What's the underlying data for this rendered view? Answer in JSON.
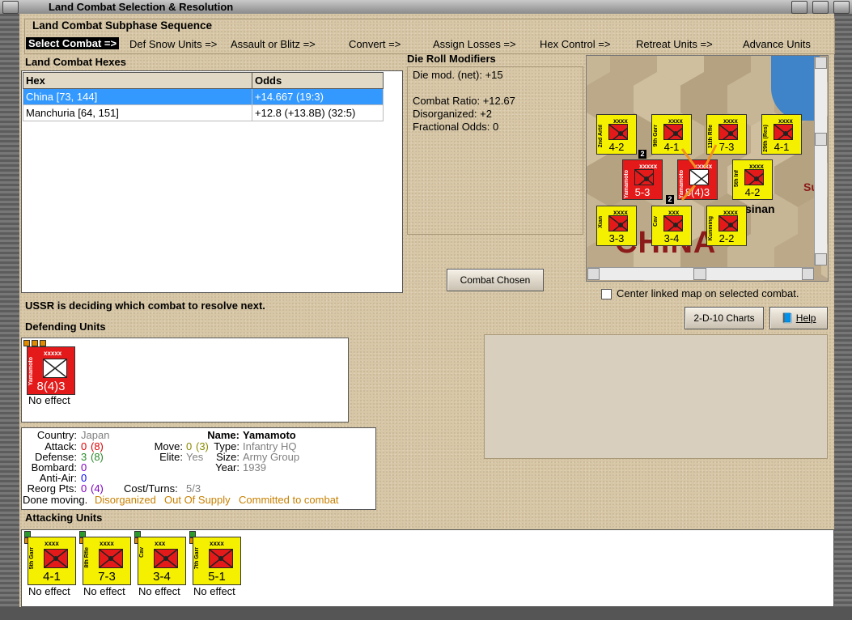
{
  "window": {
    "title": "Land Combat Selection & Resolution"
  },
  "sequence": {
    "title": "Land Combat Subphase Sequence",
    "steps": [
      "Select Combat =>",
      "Def Snow Units =>",
      "Assault or Blitz =>",
      "Convert =>",
      "Assign Losses =>",
      "Hex Control =>",
      "Retreat Units =>",
      "Advance Units"
    ],
    "active_index": 0
  },
  "hexes": {
    "title": "Land Combat Hexes",
    "columns": [
      "Hex",
      "Odds"
    ],
    "rows": [
      {
        "hex": "China [73, 144]",
        "odds": "+14.667 (19:3)",
        "selected": true
      },
      {
        "hex": "Manchuria [64, 151]",
        "odds": "+12.8 (+13.8B) (32:5)",
        "selected": false
      }
    ]
  },
  "modifiers": {
    "title": "Die Roll Modifiers",
    "die_mod": "Die mod. (net): +15",
    "combat_ratio": "Combat Ratio: +12.67",
    "disorganized": "Disorganized: +2",
    "fractional": "Fractional Odds: 0"
  },
  "map": {
    "label_china": "CHINA",
    "label_sinan": "sinan",
    "label_su": "Su",
    "stack_counts": [
      "2",
      "2"
    ]
  },
  "buttons": {
    "combat_chosen": "Combat Chosen",
    "charts": "2-D-10 Charts",
    "help": "Help"
  },
  "center_linked": {
    "label": "Center linked map on selected combat.",
    "checked": false
  },
  "status": "USSR is deciding which combat to resolve next.",
  "defending": {
    "title": "Defending Units",
    "units": [
      {
        "name": "Yamamoto",
        "size": "xxxxx",
        "strength": "8(4)3",
        "effect": "No effect",
        "color": "#e41a1a"
      }
    ]
  },
  "info": {
    "country_label": "Country:",
    "country": "Japan",
    "attack_label": "Attack:",
    "attack": "0",
    "attack_paren": "(8)",
    "defense_label": "Defense:",
    "defense": "3",
    "defense_paren": "(8)",
    "bombard_label": "Bombard:",
    "bombard": "0",
    "antiair_label": "Anti-Air:",
    "antiair": "0",
    "reorg_label": "Reorg Pts:",
    "reorg": "0",
    "reorg_paren": "(4)",
    "done": "Done moving.",
    "status_disorganized": "Disorganized",
    "status_supply": "Out Of Supply",
    "status_committed": "Committed to combat",
    "name_label": "Name:",
    "name": "Yamamoto",
    "move_label": "Move:",
    "move": "0",
    "move_paren": "(3)",
    "elite_label": "Elite:",
    "elite": "Yes",
    "type_label": "Type:",
    "type": "Infantry HQ",
    "size_label": "Size:",
    "size": "Army Group",
    "year_label": "Year:",
    "year": "1939",
    "cost_label": "Cost/Turns:",
    "cost": "5/3"
  },
  "attacking": {
    "title": "Attacking Units",
    "units": [
      {
        "name": "5th Garr",
        "size": "xxxx",
        "strength": "4-1",
        "effect": "No effect"
      },
      {
        "name": "8th Rfle",
        "size": "xxxx",
        "strength": "7-3",
        "effect": "No effect"
      },
      {
        "name": "Cav",
        "size": "xxx",
        "strength": "3-4",
        "effect": "No effect"
      },
      {
        "name": "7th Garr",
        "size": "xxxx",
        "strength": "5-1",
        "effect": "No effect"
      }
    ]
  },
  "map_units": [
    {
      "name": "2nd Artil",
      "size": "xxxx",
      "strength": "4-2"
    },
    {
      "name": "9th Garr",
      "size": "xxxx",
      "strength": "4-1"
    },
    {
      "name": "11th Rfle",
      "size": "xxxx",
      "strength": "7-3"
    },
    {
      "name": "29th (Res)",
      "size": "xxxx",
      "strength": "4-1"
    },
    {
      "name": "Yamamoto",
      "size": "xxxxx",
      "strength": "5-3"
    },
    {
      "name": "Yamamoto",
      "size": "xxxxx",
      "strength": "8(4)3"
    },
    {
      "name": "5th Inf",
      "size": "xxxx",
      "strength": "4-2"
    },
    {
      "name": "Xian",
      "size": "xxxx",
      "strength": "3-3"
    },
    {
      "name": "Cav",
      "size": "xxx",
      "strength": "3-4"
    },
    {
      "name": "Kunming",
      "size": "xxxx",
      "strength": "2-2"
    }
  ]
}
